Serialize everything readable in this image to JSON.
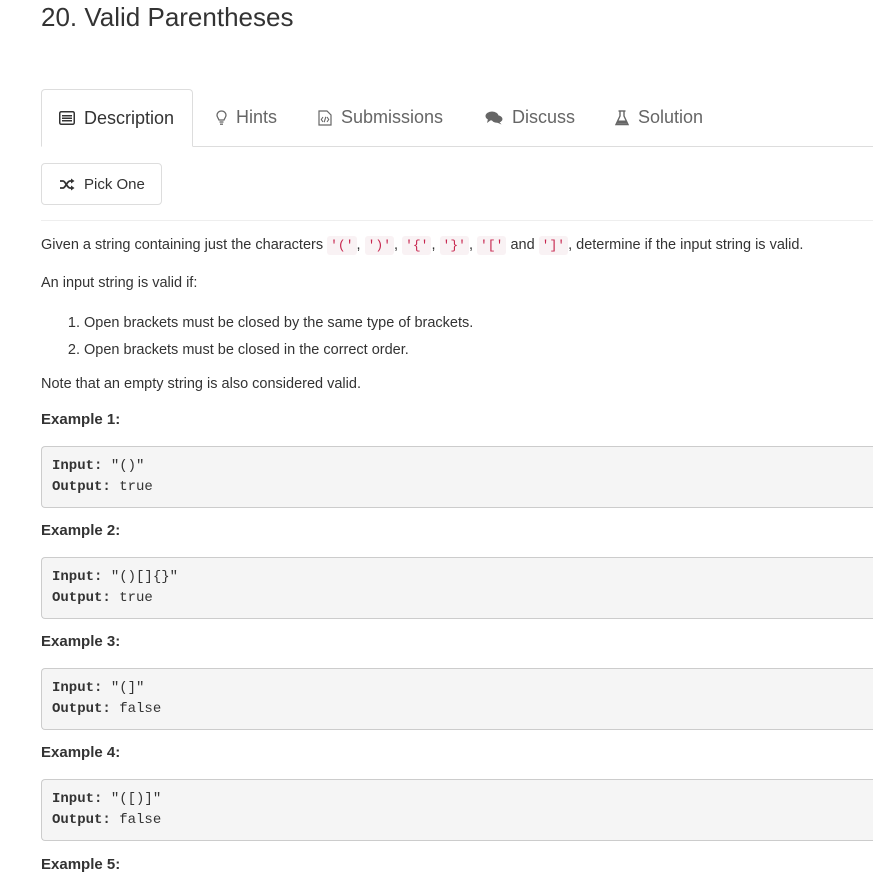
{
  "problem": {
    "title": "20. Valid Parentheses"
  },
  "tabs": [
    {
      "label": "Description",
      "icon": "description-icon",
      "active": true
    },
    {
      "label": "Hints",
      "icon": "lightbulb-icon",
      "active": false
    },
    {
      "label": "Submissions",
      "icon": "code-file-icon",
      "active": false
    },
    {
      "label": "Discuss",
      "icon": "comments-icon",
      "active": false
    },
    {
      "label": "Solution",
      "icon": "flask-icon",
      "active": false
    }
  ],
  "pick_one": {
    "label": "Pick One",
    "icon": "shuffle-icon"
  },
  "description": {
    "intro_prefix": "Given a string containing just the characters",
    "chars": [
      "'('",
      "')'",
      "'{'",
      "'}'",
      "'['",
      "']'"
    ],
    "sep": ",",
    "and": "and",
    "intro_suffix": ", determine if the input string is valid.",
    "valid_if": "An input string is valid if:",
    "rules": [
      "Open brackets must be closed by the same type of brackets.",
      "Open brackets must be closed in the correct order."
    ],
    "note": "Note that an empty string is also considered valid."
  },
  "examples": [
    {
      "title": "Example 1:",
      "input_label": "Input:",
      "input": " \"()\"",
      "output_label": "Output:",
      "output": " true"
    },
    {
      "title": "Example 2:",
      "input_label": "Input:",
      "input": " \"()[]{}\"",
      "output_label": "Output:",
      "output": " true"
    },
    {
      "title": "Example 3:",
      "input_label": "Input:",
      "input": " \"(]\"",
      "output_label": "Output:",
      "output": " false"
    },
    {
      "title": "Example 4:",
      "input_label": "Input:",
      "input": " \"([)]\"",
      "output_label": "Output:",
      "output": " false"
    },
    {
      "title": "Example 5:"
    }
  ],
  "colors": {
    "inline_code": "#c7254e",
    "inline_code_bg": "#f9f2f4",
    "pre_bg": "#f5f5f5"
  }
}
